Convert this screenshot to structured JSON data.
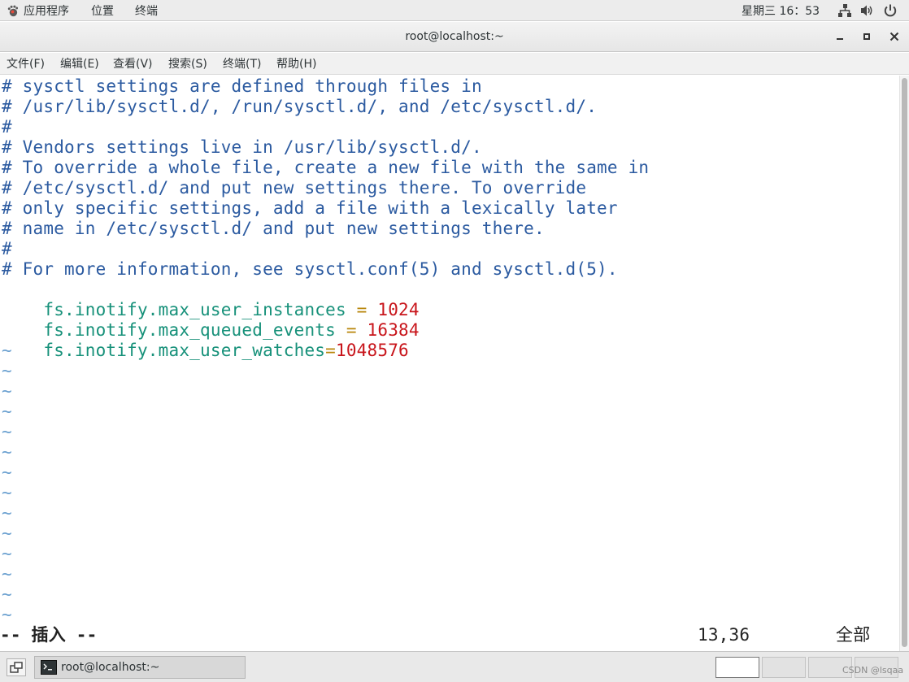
{
  "topbar": {
    "apps": "应用程序",
    "places": "位置",
    "terminal": "终端",
    "clock": "星期三 16：53",
    "icons": [
      "network-icon",
      "volume-icon",
      "power-icon"
    ]
  },
  "window": {
    "title": "root@localhost:~"
  },
  "menubar": {
    "items": [
      "文件(F)",
      "编辑(E)",
      "查看(V)",
      "搜索(S)",
      "终端(T)",
      "帮助(H)"
    ]
  },
  "editor": {
    "comment_lines": [
      "# sysctl settings are defined through files in",
      "# /usr/lib/sysctl.d/, /run/sysctl.d/, and /etc/sysctl.d/.",
      "#",
      "# Vendors settings live in /usr/lib/sysctl.d/.",
      "# To override a whole file, create a new file with the same in",
      "# /etc/sysctl.d/ and put new settings there. To override",
      "# only specific settings, add a file with a lexically later",
      "# name in /etc/sysctl.d/ and put new settings there.",
      "#",
      "# For more information, see sysctl.conf(5) and sysctl.d(5)."
    ],
    "settings": [
      {
        "key": "fs.inotify.max_user_instances",
        "op": " = ",
        "value": "1024"
      },
      {
        "key": "fs.inotify.max_queued_events",
        "op": " = ",
        "value": "16384"
      },
      {
        "key": "fs.inotify.max_user_watches",
        "op": "=",
        "value": "1048576"
      }
    ],
    "tilde": "~",
    "status_mode": "-- 插入 --",
    "status_position": "13,36",
    "status_extent": "全部"
  },
  "taskbar": {
    "window_label": "root@localhost:~",
    "watermark": "CSDN @lsqaa"
  },
  "colors": {
    "comment": "#2b5aa0",
    "key": "#17917a",
    "operator": "#b8860b",
    "number": "#c8151b"
  }
}
